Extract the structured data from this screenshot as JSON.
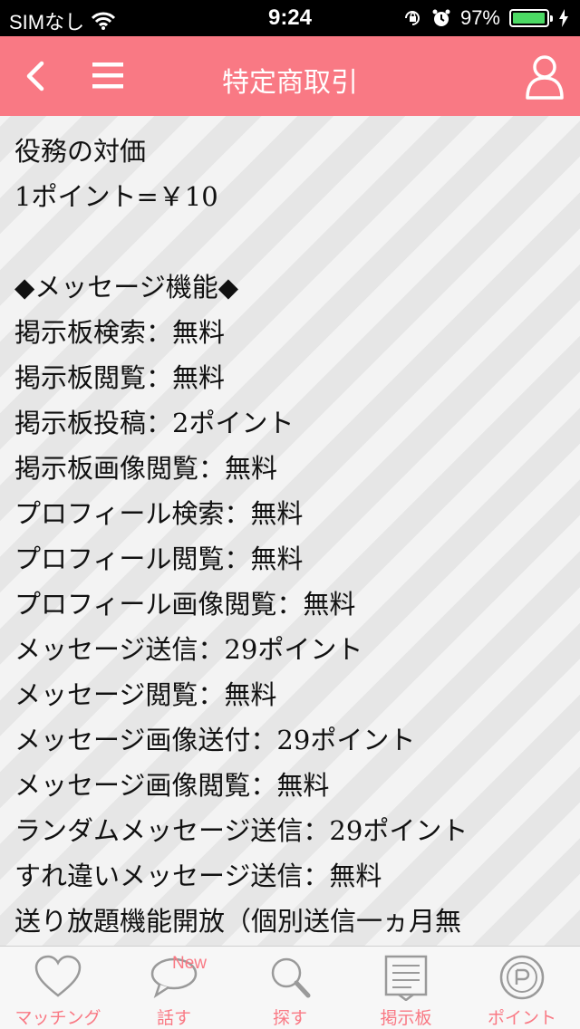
{
  "status_bar": {
    "carrier": "SIMなし",
    "time": "9:24",
    "battery_percent": "97%",
    "battery_level": 0.97
  },
  "header": {
    "title": "特定商取引"
  },
  "content": {
    "lines": [
      "役務の対価",
      "1ポイント=￥10",
      "",
      "◆メッセージ機能◆",
      "掲示板検索：無料",
      "掲示板閲覧：無料",
      "掲示板投稿：2ポイント",
      "掲示板画像閲覧：無料",
      "プロフィール検索：無料",
      "プロフィール閲覧：無料",
      "プロフィール画像閲覧：無料",
      "メッセージ送信：29ポイント",
      "メッセージ閲覧：無料",
      "メッセージ画像送付：29ポイント",
      "メッセージ画像閲覧：無料",
      "ランダムメッセージ送信：29ポイント",
      "すれ違いメッセージ送信：無料",
      "送り放題機能開放（個別送信一ヵ月無"
    ]
  },
  "tabs": [
    {
      "label": "マッチング",
      "icon": "heart-icon"
    },
    {
      "label": "話す",
      "icon": "speech-bubble-icon",
      "badge": "New"
    },
    {
      "label": "探す",
      "icon": "magnifier-icon"
    },
    {
      "label": "掲示板",
      "icon": "bulletin-board-icon"
    },
    {
      "label": "ポイント",
      "icon": "coin-icon"
    }
  ],
  "colors": {
    "accent": "#f97984",
    "battery": "#4cd964"
  }
}
